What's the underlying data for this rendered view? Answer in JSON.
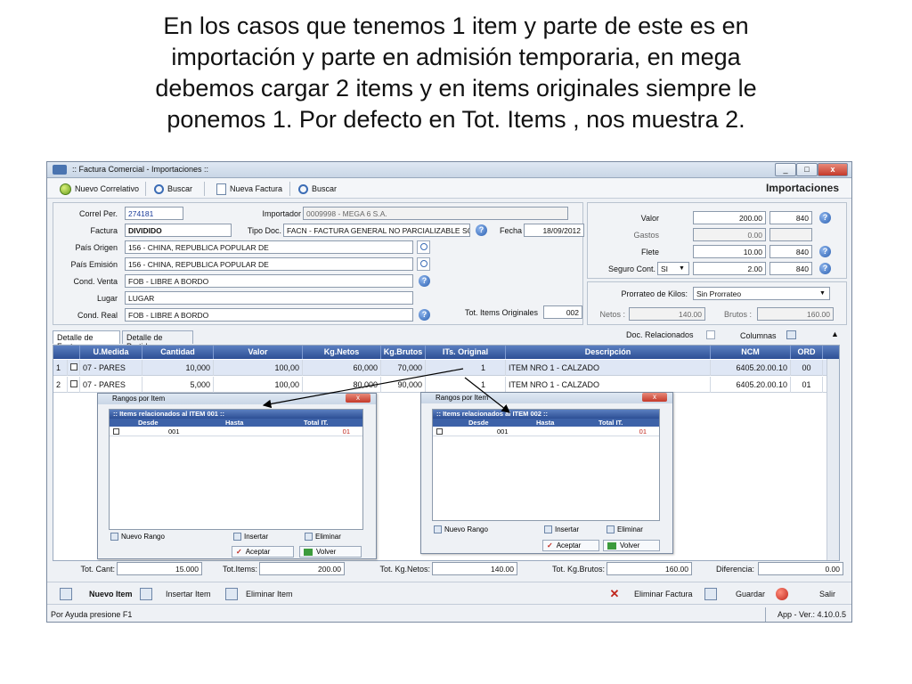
{
  "caption": {
    "line1": "En los casos que tenemos 1 item y parte de este es en",
    "line2": "importación y parte en admisión temporaria, en mega",
    "line3": "debemos cargar 2 items y en items originales siempre le",
    "line4": "ponemos 1. Por defecto en Tot. Items , nos muestra 2."
  },
  "window": {
    "title": ":: Factura Comercial - Importaciones ::",
    "app_title": "Importaciones",
    "controls": {
      "minimize": "_",
      "maximize": "□",
      "close": "x"
    }
  },
  "toolbar": {
    "nuevo_correlativo": "Nuevo Correlativo",
    "buscar": "Buscar",
    "nueva_factura": "Nueva Factura",
    "buscar2": "Buscar"
  },
  "form": {
    "correl_per": {
      "label": "Correl Per.",
      "value": "274181"
    },
    "importador": {
      "label": "Importador",
      "value": "0009998 - MEGA 6 S.A."
    },
    "factura": {
      "label": "Factura",
      "value": "DIVIDIDO"
    },
    "tipo_doc": {
      "label": "Tipo Doc.",
      "value": "FACN - FACTURA GENERAL NO PARCIALIZABLE SOLO"
    },
    "fecha": {
      "label": "Fecha",
      "value": "18/09/2012"
    },
    "pais_origen": {
      "label": "País Origen",
      "value": "156 - CHINA, REPUBLICA POPULAR DE"
    },
    "pais_emision": {
      "label": "País Emisión",
      "value": "156 - CHINA, REPUBLICA POPULAR DE"
    },
    "cond_venta": {
      "label": "Cond. Venta",
      "value": "FOB - LIBRE A BORDO"
    },
    "lugar": {
      "label": "Lugar",
      "value": "LUGAR"
    },
    "cond_real": {
      "label": "Cond. Real",
      "value": "FOB - LIBRE A BORDO"
    },
    "tot_items_originales": {
      "label": "Tot. Items Originales",
      "value": "002"
    }
  },
  "values": {
    "valor": {
      "label": "Valor",
      "amount": "200.00",
      "currency": "840"
    },
    "gastos": {
      "label": "Gastos",
      "amount": "0.00"
    },
    "flete": {
      "label": "Flete",
      "amount": "10.00",
      "currency": "840"
    },
    "seguro": {
      "label": "Seguro Cont.",
      "select": "SI",
      "amount": "2.00",
      "currency": "840"
    },
    "prorrateo": {
      "label": "Prorrateo de Kilos:",
      "value": "Sin Prorrateo"
    },
    "netos": {
      "label": "Netos :",
      "value": "140.00"
    },
    "brutos": {
      "label": "Brutos :",
      "value": "160.00"
    }
  },
  "tabs": {
    "detalle_factura": "Detalle de Factura",
    "detalle_partidas": "Detalle de Partidas",
    "doc_relacionados": "Doc. Relacionados",
    "columnas": "Columnas"
  },
  "grid": {
    "headers": [
      "U.Medida",
      "Cantidad",
      "Valor",
      "Kg.Netos",
      "Kg.Brutos",
      "ITs. Original",
      "Descripción",
      "NCM",
      "ORD"
    ],
    "rows": [
      {
        "num": "1",
        "umedida": "07 - PARES",
        "cantidad": "10,000",
        "valor": "100,00",
        "kgnetos": "60,000",
        "kgbrutos": "70,000",
        "its": "1",
        "desc": "ITEM NRO 1 - CALZADO",
        "ncm": "6405.20.00.10",
        "ord": "00"
      },
      {
        "num": "2",
        "umedida": "07 - PARES",
        "cantidad": "5,000",
        "valor": "100,00",
        "kgnetos": "80,000",
        "kgbrutos": "90,000",
        "its": "1",
        "desc": "ITEM NRO 1 - CALZADO",
        "ncm": "6405.20.00.10",
        "ord": "01"
      }
    ]
  },
  "dialog1": {
    "title": "Rangos por Item",
    "subtitle": ":: Items relacionados al ITEM  001 ::",
    "cols": [
      "Desde",
      "Hasta",
      "Total IT."
    ],
    "row": {
      "desde": "001",
      "hasta": "",
      "total": "01"
    },
    "nuevo_rango": "Nuevo Rango",
    "insertar": "Insertar",
    "eliminar": "Eliminar",
    "aceptar": "Aceptar",
    "volver": "Volver"
  },
  "dialog2": {
    "title": "Rangos por Item",
    "subtitle": ":: Items relacionados al ITEM  002 ::",
    "cols": [
      "Desde",
      "Hasta",
      "Total IT."
    ],
    "row": {
      "desde": "001",
      "hasta": "",
      "total": "01"
    },
    "nuevo_rango": "Nuevo Rango",
    "insertar": "Insertar",
    "eliminar": "Eliminar",
    "aceptar": "Aceptar",
    "volver": "Volver"
  },
  "totals": {
    "tot_cant": {
      "label": "Tot. Cant:",
      "value": "15.000"
    },
    "tot_items": {
      "label": "Tot.Items:",
      "value": "200.00"
    },
    "tot_kgnetos": {
      "label": "Tot. Kg.Netos:",
      "value": "140.00"
    },
    "tot_kgbrutos": {
      "label": "Tot. Kg.Brutos:",
      "value": "160.00"
    },
    "diferencia": {
      "label": "Diferencia:",
      "value": "0.00"
    }
  },
  "bottom": {
    "nuevo_item": "Nuevo Item",
    "insertar_item": "Insertar Item",
    "eliminar_item": "Eliminar Item",
    "eliminar_factura": "Eliminar Factura",
    "guardar": "Guardar",
    "salir": "Salir"
  },
  "status": {
    "help": "Por Ayuda presione F1",
    "version": "App - Ver.: 4.10.0.5"
  }
}
